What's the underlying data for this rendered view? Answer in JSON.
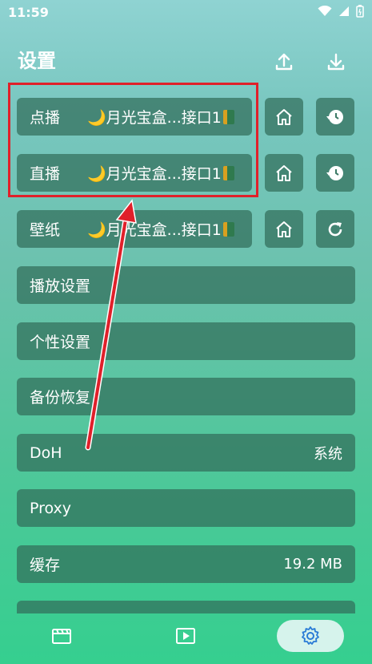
{
  "status": {
    "time": "11:59"
  },
  "header": {
    "title": "设置"
  },
  "rows": [
    {
      "label": "点播",
      "value": "🌙月光宝盒...接口1"
    },
    {
      "label": "直播",
      "value": "🌙月光宝盒...接口1"
    },
    {
      "label": "壁纸",
      "value": "🌙月光宝盒...接口1"
    },
    {
      "label": "播放设置"
    },
    {
      "label": "个性设置"
    },
    {
      "label": "备份恢复"
    },
    {
      "label": "DoH",
      "value": "系统"
    },
    {
      "label": "Proxy"
    },
    {
      "label": "缓存",
      "value": "19.2 MB"
    }
  ],
  "icons": {
    "upload": "upload-icon",
    "download": "download-icon",
    "home": "home-icon",
    "history": "history-icon",
    "refresh": "refresh-icon",
    "film": "film-icon",
    "play": "play-icon",
    "settings": "settings-icon"
  },
  "colors": {
    "highlight": "#e0202a",
    "card": "#326e5a",
    "nav_active": "#d6f3ec",
    "nav_icon_active": "#2a7bd6"
  }
}
